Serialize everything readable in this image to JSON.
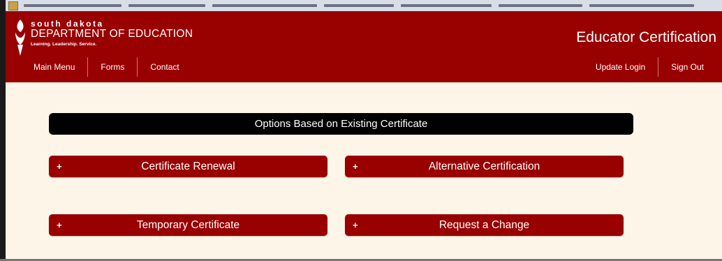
{
  "logo": {
    "line1": "south dakota",
    "line2": "DEPARTMENT OF EDUCATION",
    "tagline": "Learning. Leadership. Service."
  },
  "site_title": "Educator Certification",
  "nav": {
    "left": [
      "Main Menu",
      "Forms",
      "Contact"
    ],
    "right": [
      "Update Login",
      "Sign Out"
    ]
  },
  "section_title": "Options Based on Existing Certificate",
  "options": [
    {
      "icon": "+",
      "label": "Certificate Renewal"
    },
    {
      "icon": "+",
      "label": "Alternative Certification"
    },
    {
      "icon": "+",
      "label": "Temporary Certificate"
    },
    {
      "icon": "+",
      "label": "Request a Change"
    }
  ],
  "colors": {
    "brand": "#990000",
    "page_background": "#fdf5e8",
    "section_bar": "#000000"
  }
}
